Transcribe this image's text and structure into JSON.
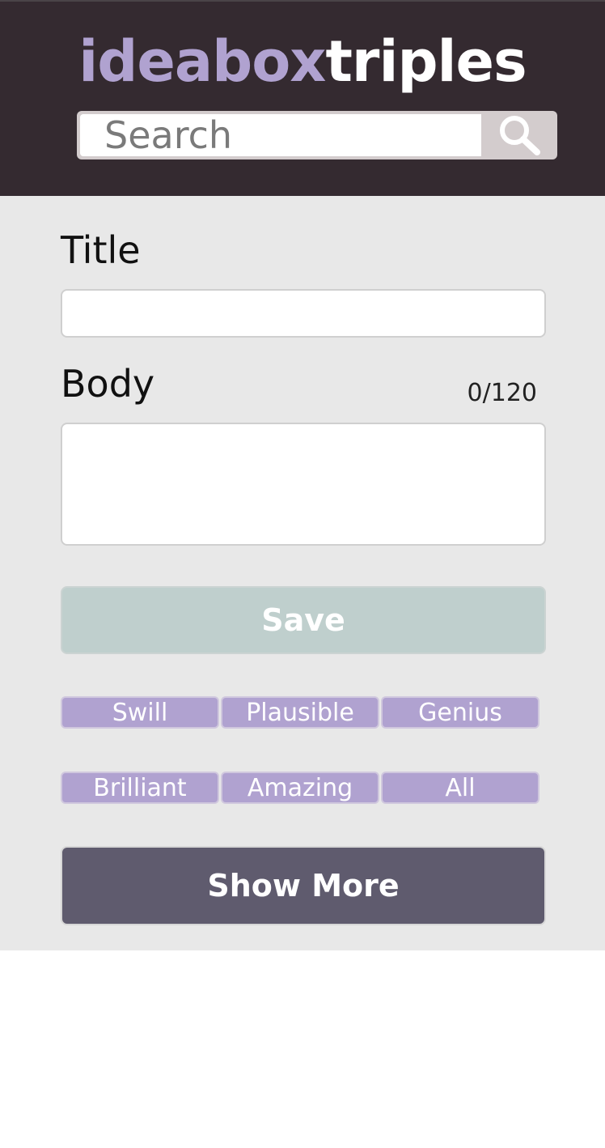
{
  "header": {
    "logo_part_1": "ideabox",
    "logo_part_2": "triples",
    "search_placeholder": "Search",
    "search_icon": "magnifier-icon"
  },
  "form": {
    "title_label": "Title",
    "title_value": "",
    "body_label": "Body",
    "body_value": "",
    "char_counter": "0/120",
    "save_label": "Save"
  },
  "filters": [
    "Swill",
    "Plausible",
    "Genius",
    "Brilliant",
    "Amazing",
    "All"
  ],
  "show_more_label": "Show More",
  "colors": {
    "header_bg": "#342a30",
    "accent_purple": "#b0a2d0",
    "save_disabled": "#bfcfcd",
    "show_more_bg": "#5f5b6e",
    "main_bg": "#e8e8e8"
  }
}
